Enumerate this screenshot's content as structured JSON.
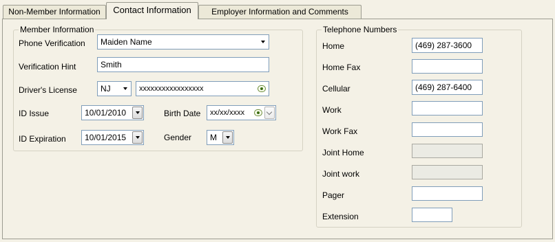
{
  "tabs": [
    {
      "label": "Non-Member Information",
      "active": false
    },
    {
      "label": "Contact Information",
      "active": true
    },
    {
      "label": "Employer Information and Comments",
      "active": false
    }
  ],
  "member": {
    "legend": "Member Information",
    "phone_verification": {
      "label": "Phone Verification",
      "value": "Maiden Name"
    },
    "verification_hint": {
      "label": "Verification Hint",
      "value": "Smith"
    },
    "drivers_license": {
      "label": "Driver's License",
      "state": "NJ",
      "number": "xxxxxxxxxxxxxxxxx"
    },
    "id_issue": {
      "label": "ID Issue",
      "value": "10/01/2010"
    },
    "birth_date": {
      "label": "Birth Date",
      "value": "xx/xx/xxxx"
    },
    "id_expiration": {
      "label": "ID Expiration",
      "value": "10/01/2015"
    },
    "gender": {
      "label": "Gender",
      "value": "M"
    }
  },
  "phones": {
    "legend": "Telephone Numbers",
    "rows": [
      {
        "label": "Home",
        "value": "(469) 287-3600",
        "enabled": true
      },
      {
        "label": "Home Fax",
        "value": "",
        "enabled": true
      },
      {
        "label": "Cellular",
        "value": "(469) 287-6400",
        "enabled": true
      },
      {
        "label": "Work",
        "value": "",
        "enabled": true
      },
      {
        "label": "Work Fax",
        "value": "",
        "enabled": true
      },
      {
        "label": "Joint Home",
        "value": "",
        "enabled": false
      },
      {
        "label": "Joint work",
        "value": "",
        "enabled": false
      },
      {
        "label": "Pager",
        "value": "",
        "enabled": true
      },
      {
        "label": "Extension",
        "value": "",
        "enabled": true
      }
    ]
  },
  "icons": {
    "reveal": "eye-icon",
    "dropdown": "chevron-down-icon"
  }
}
